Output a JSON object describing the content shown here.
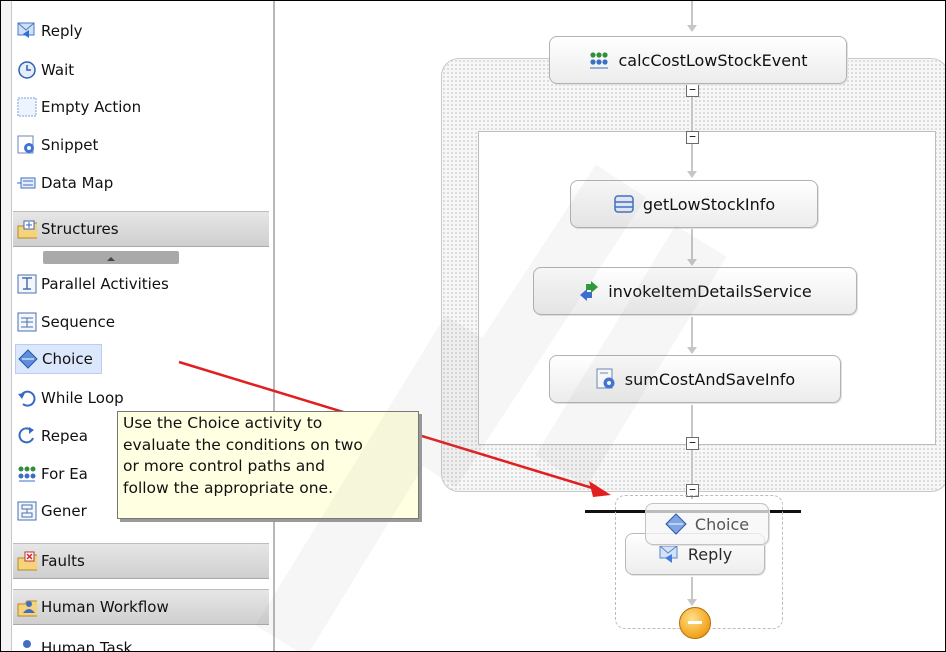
{
  "palette": {
    "items_top": [
      {
        "label": "Reply",
        "icon": "reply-icon"
      },
      {
        "label": "Wait",
        "icon": "clock-icon"
      },
      {
        "label": "Empty Action",
        "icon": "empty-action-icon"
      },
      {
        "label": "Snippet",
        "icon": "snippet-icon"
      },
      {
        "label": "Data Map",
        "icon": "data-map-icon"
      }
    ],
    "drawer_structures": "Structures",
    "items_structures": [
      {
        "label": "Parallel Activities",
        "icon": "parallel-icon"
      },
      {
        "label": "Sequence",
        "icon": "sequence-icon"
      },
      {
        "label": "Choice",
        "icon": "choice-icon"
      },
      {
        "label": "While Loop",
        "icon": "while-loop-icon"
      },
      {
        "label": "Repea",
        "icon": "repeat-icon"
      },
      {
        "label": "For Ea",
        "icon": "for-each-icon"
      },
      {
        "label": "Gener",
        "icon": "generalized-flow-icon"
      }
    ],
    "drawer_faults": "Faults",
    "drawer_human": "Human Workflow",
    "items_human": [
      {
        "label": "Human Task",
        "icon": "human-task-icon"
      }
    ]
  },
  "tooltip": {
    "lines": [
      "Use the Choice activity to",
      "evaluate the conditions on two",
      "or more control paths and",
      "follow the appropriate one."
    ]
  },
  "canvas": {
    "activities": {
      "calc": "calcCostLowStockEvent",
      "get": "getLowStockInfo",
      "invoke": "invokeItemDetailsService",
      "sum": "sumCostAndSaveInfo",
      "reply": "Reply",
      "choice_drag": "Choice"
    },
    "collapse_glyph": "−"
  },
  "colors": {
    "accent_arrow": "#e02020",
    "tooltip_bg": "#ffffe1",
    "selection": "#dbe7fb"
  }
}
